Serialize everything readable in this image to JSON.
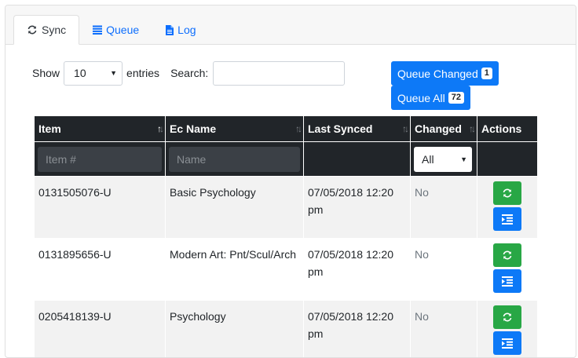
{
  "tabs": [
    {
      "label": "Sync",
      "icon": "sync-icon",
      "active": true
    },
    {
      "label": "Queue",
      "icon": "list-icon",
      "active": false
    },
    {
      "label": "Log",
      "icon": "file-icon",
      "active": false
    }
  ],
  "controls": {
    "show_label": "Show",
    "entries_value": "10",
    "entries_label": "entries",
    "search_label": "Search:",
    "search_value": ""
  },
  "buttons": {
    "queue_changed_label": "Queue Changed",
    "queue_changed_count": "1",
    "queue_all_label": "Queue All",
    "queue_all_count": "72"
  },
  "table": {
    "headers": [
      "Item",
      "Ec Name",
      "Last Synced",
      "Changed",
      "Actions"
    ],
    "filters": {
      "item_placeholder": "Item #",
      "name_placeholder": "Name",
      "changed_value": "All"
    },
    "rows": [
      {
        "item": "0131505076-U",
        "name": "Basic Psychology",
        "last_synced": "07/05/2018 12:20 pm",
        "changed": "No"
      },
      {
        "item": "0131895656-U",
        "name": "Modern Art: Pnt/Scul/Arch",
        "last_synced": "07/05/2018 12:20 pm",
        "changed": "No"
      },
      {
        "item": "0205418139-U",
        "name": "Psychology",
        "last_synced": "07/05/2018 12:20 pm",
        "changed": "No"
      }
    ]
  },
  "colors": {
    "primary": "#0d79f7",
    "success": "#28a745",
    "header_dark": "#212529"
  }
}
